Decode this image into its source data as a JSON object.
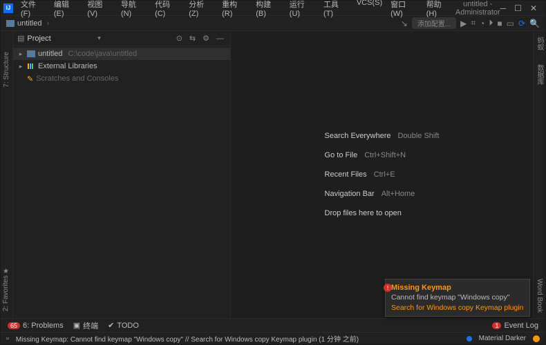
{
  "window": {
    "title": "untitled - Administrator",
    "menus": [
      "文件(F)",
      "编辑(E)",
      "视图(V)",
      "导航(N)",
      "代码(C)",
      "分析(Z)",
      "重构(R)",
      "构建(B)",
      "运行(U)",
      "工具(T)",
      "VCS(S)",
      "窗口(W)",
      "帮助(H)"
    ]
  },
  "breadcrumb": {
    "project": "untitled"
  },
  "run": {
    "config_label": "添加配置..."
  },
  "project_panel": {
    "title": "Project",
    "root": {
      "name": "untitled",
      "path": "C:\\code\\java\\untitled"
    },
    "external": "External Libraries",
    "scratches": "Scratches and Consoles"
  },
  "gutters": {
    "structure": "7: Structure",
    "favorites": "2: Favorites",
    "ant": "蚂蚁",
    "database": "数据库",
    "wordbook": "Word Book"
  },
  "welcome": {
    "r1a": "Search Everywhere",
    "r1b": "Double Shift",
    "r2a": "Go to File",
    "r2b": "Ctrl+Shift+N",
    "r3a": "Recent Files",
    "r3b": "Ctrl+E",
    "r4a": "Navigation Bar",
    "r4b": "Alt+Home",
    "r5a": "Drop files here to open"
  },
  "notification": {
    "title": "Missing Keymap",
    "body": "Cannot find keymap \"Windows copy\"",
    "link": "Search for Windows copy Keymap plugin"
  },
  "bottom": {
    "problems": "6: Problems",
    "problems_count": "65",
    "terminal": "终端",
    "todo": "TODO",
    "eventlog": "Event Log",
    "eventlog_count": "1"
  },
  "status": {
    "msg": "Missing Keymap: Cannot find keymap \"Windows copy\" // Search for Windows copy Keymap plugin (1 分钟 之前)",
    "theme": "Material Darker"
  }
}
